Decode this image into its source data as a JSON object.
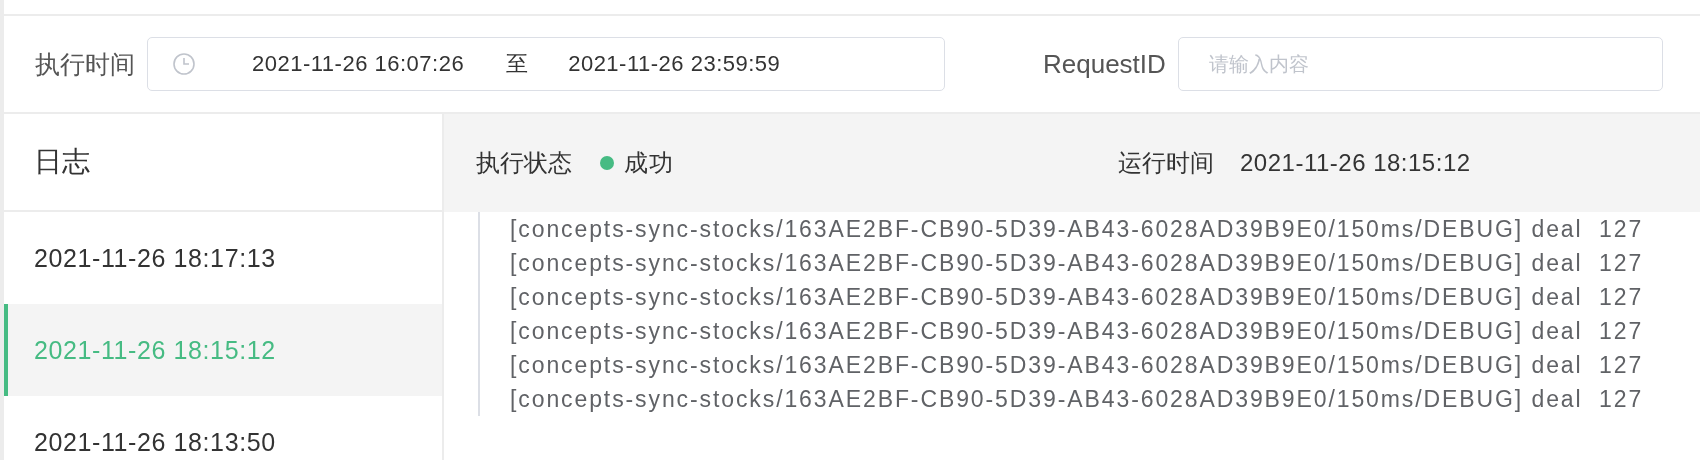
{
  "filters": {
    "time_label": "执行时间",
    "range_start": "2021-11-26 16:07:26",
    "range_separator": "至",
    "range_end": "2021-11-26 23:59:59",
    "request_label": "RequestID",
    "request_field": {
      "placeholder": "请输入内容"
    }
  },
  "log_list": {
    "title": "日志",
    "items": [
      {
        "label": "2021-11-26 18:17:13",
        "selected": false
      },
      {
        "label": "2021-11-26 18:15:12",
        "selected": true
      },
      {
        "label": "2021-11-26 18:13:50",
        "selected": false
      }
    ]
  },
  "detail": {
    "status_label": "执行状态",
    "status": {
      "text": "成功",
      "kind": "success"
    },
    "run_time_label": "运行时间",
    "run_time": "2021-11-26 18:15:12",
    "lines": [
      "[concepts-sync-stocks/163AE2BF-CB90-5D39-AB43-6028AD39B9E0/150ms/DEBUG] deal  127",
      "[concepts-sync-stocks/163AE2BF-CB90-5D39-AB43-6028AD39B9E0/150ms/DEBUG] deal  127",
      "[concepts-sync-stocks/163AE2BF-CB90-5D39-AB43-6028AD39B9E0/150ms/DEBUG] deal  127",
      "[concepts-sync-stocks/163AE2BF-CB90-5D39-AB43-6028AD39B9E0/150ms/DEBUG] deal  127",
      "[concepts-sync-stocks/163AE2BF-CB90-5D39-AB43-6028AD39B9E0/150ms/DEBUG] deal  127",
      "[concepts-sync-stocks/163AE2BF-CB90-5D39-AB43-6028AD39B9E0/150ms/DEBUG] deal  127"
    ]
  }
}
